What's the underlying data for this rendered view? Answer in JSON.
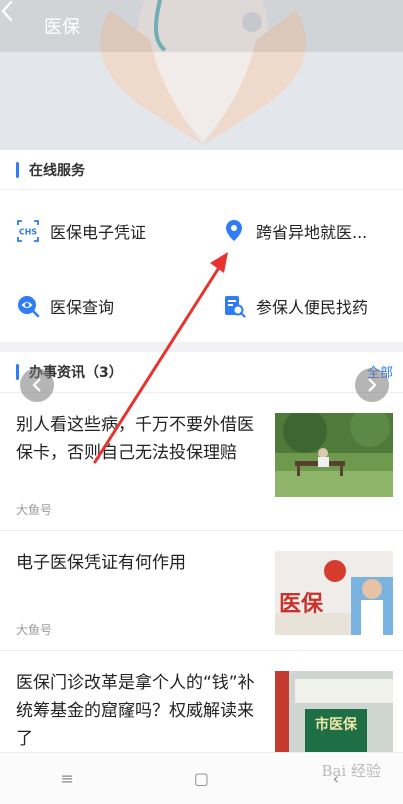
{
  "header": {
    "title": "医保"
  },
  "online_services": {
    "heading": "在线服务",
    "items": [
      {
        "label": "医保电子凭证",
        "icon": "chs-card-icon"
      },
      {
        "label": "跨省异地就医...",
        "icon": "location-pin-icon"
      },
      {
        "label": "医保查询",
        "icon": "search-eye-icon"
      },
      {
        "label": "参保人便民找药",
        "icon": "medicine-search-icon"
      }
    ]
  },
  "news": {
    "heading": "办事资讯（3）",
    "all_label": "全部",
    "items": [
      {
        "title": "别人看这些病，千万不要外借医保卡，否则自己无法投保理赔",
        "source": "大鱼号"
      },
      {
        "title": "电子医保凭证有何作用",
        "source": "大鱼号",
        "thumb_text": "医保"
      },
      {
        "title": "医保门诊改革是拿个人的“钱”补统筹基金的窟窿吗？权威解读来了",
        "source": "",
        "thumb_text": "市医保"
      }
    ]
  },
  "navbar": {
    "menu": "≡",
    "home": "▢",
    "back": "‹"
  },
  "watermark": "Bai 经验",
  "colors": {
    "accent": "#2f7cf6",
    "annotation_arrow": "#e8322d"
  }
}
